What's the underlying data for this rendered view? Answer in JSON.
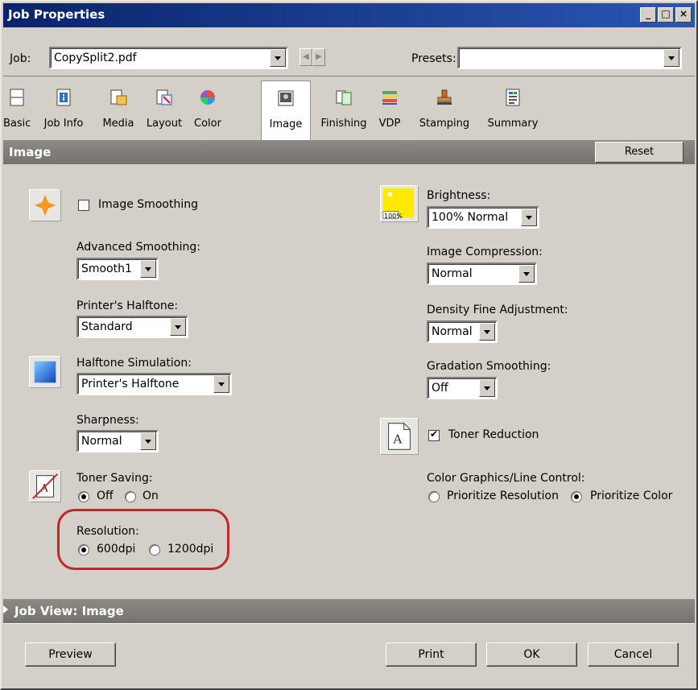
{
  "window": {
    "title": "Job Properties",
    "controls": [
      "_",
      "□",
      "×"
    ]
  },
  "job": {
    "label": "Job:",
    "value": "CopySplit2.pdf"
  },
  "presets": {
    "label": "Presets:",
    "value": ""
  },
  "tabs": [
    {
      "label": "Basic",
      "icon": "basic-icon"
    },
    {
      "label": "Job Info",
      "icon": "job-info-icon"
    },
    {
      "label": "Media",
      "icon": "media-icon"
    },
    {
      "label": "Layout",
      "icon": "layout-icon"
    },
    {
      "label": "Color",
      "icon": "color-icon"
    },
    {
      "label": "Image",
      "icon": "image-icon",
      "active": true
    },
    {
      "label": "Finishing",
      "icon": "finishing-icon"
    },
    {
      "label": "VDP",
      "icon": "vdp-icon"
    },
    {
      "label": "Stamping",
      "icon": "stamping-icon"
    },
    {
      "label": "Summary",
      "icon": "summary-icon"
    }
  ],
  "section": {
    "title": "Image",
    "reset_label": "Reset"
  },
  "left": {
    "image_smoothing": {
      "label": "Image Smoothing",
      "checked": false
    },
    "advanced_smoothing": {
      "label": "Advanced Smoothing:",
      "value": "Smooth1"
    },
    "printers_halftone": {
      "label": "Printer's Halftone:",
      "value": "Standard"
    },
    "halftone_simulation": {
      "label": "Halftone Simulation:",
      "value": "Printer's Halftone"
    },
    "sharpness": {
      "label": "Sharpness:",
      "value": "Normal"
    },
    "toner_saving": {
      "label": "Toner Saving:",
      "off_label": "Off",
      "on_label": "On",
      "selected": "Off"
    },
    "resolution": {
      "label": "Resolution:",
      "opt1_label": "600dpi",
      "opt2_label": "1200dpi",
      "selected": "600dpi"
    }
  },
  "right": {
    "brightness": {
      "label": "Brightness:",
      "value": "100% Normal",
      "badge": "100%"
    },
    "image_compression": {
      "label": "Image Compression:",
      "value": "Normal"
    },
    "density_fine_adjustment": {
      "label": "Density Fine Adjustment:",
      "value": "Normal"
    },
    "gradation_smoothing": {
      "label": "Gradation Smoothing:",
      "value": "Off"
    },
    "toner_reduction": {
      "label": "Toner Reduction",
      "checked": true
    },
    "color_graphics": {
      "label": "Color Graphics/Line Control:",
      "opt1_label": "Prioritize Resolution",
      "opt2_label": "Prioritize Color",
      "selected": "Prioritize Color"
    }
  },
  "job_view": {
    "label": "Job View: Image"
  },
  "buttons": {
    "preview": "Preview",
    "print": "Print",
    "ok": "OK",
    "cancel": "Cancel"
  },
  "colors": {
    "title_bar": "#0a246a",
    "highlight": "#c0272d",
    "face": "#d4d0c8"
  }
}
